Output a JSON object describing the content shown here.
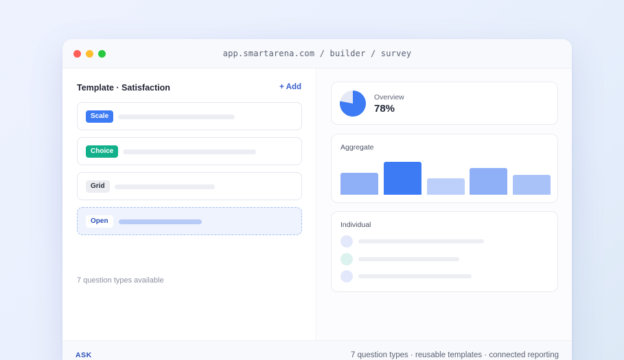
{
  "browser": {
    "url": "app.smartarena.com / builder / survey"
  },
  "builder": {
    "template_title": "Template · Satisfaction",
    "add_label": "+ Add",
    "question_types": [
      {
        "label": "Scale",
        "color": "#3d7bf4",
        "style": "scale"
      },
      {
        "label": "Choice",
        "color": "#12b08a",
        "style": "choice"
      },
      {
        "label": "Grid",
        "color": "#ebedf1",
        "style": "grid"
      },
      {
        "label": "Open",
        "color": "#ffffff",
        "style": "open",
        "active": true
      }
    ],
    "available_text": "7 question types available"
  },
  "overview": {
    "label": "Overview",
    "value": "78%",
    "percent": 78
  },
  "aggregate": {
    "title": "Aggregate",
    "chart_data": {
      "type": "bar",
      "categories": [
        "",
        "",
        "",
        "",
        ""
      ],
      "values": [
        32,
        48,
        24,
        39,
        29
      ],
      "colors": [
        "#8fb0f7",
        "#3d7bf4",
        "#bdd0fb",
        "#8fb0f7",
        "#a9c3f9"
      ]
    }
  },
  "individual": {
    "title": "Individual",
    "rows": [
      {
        "avatar_color": "#e3e9fb"
      },
      {
        "avatar_color": "#dcf2ee"
      },
      {
        "avatar_color": "#e3e9fb"
      }
    ]
  },
  "footer": {
    "brand": "ASK",
    "tagline": "7 question types · reusable templates · connected reporting"
  },
  "colors": {
    "accent": "#3d7bf4",
    "link": "#3a5fcf",
    "success": "#12b08a"
  }
}
